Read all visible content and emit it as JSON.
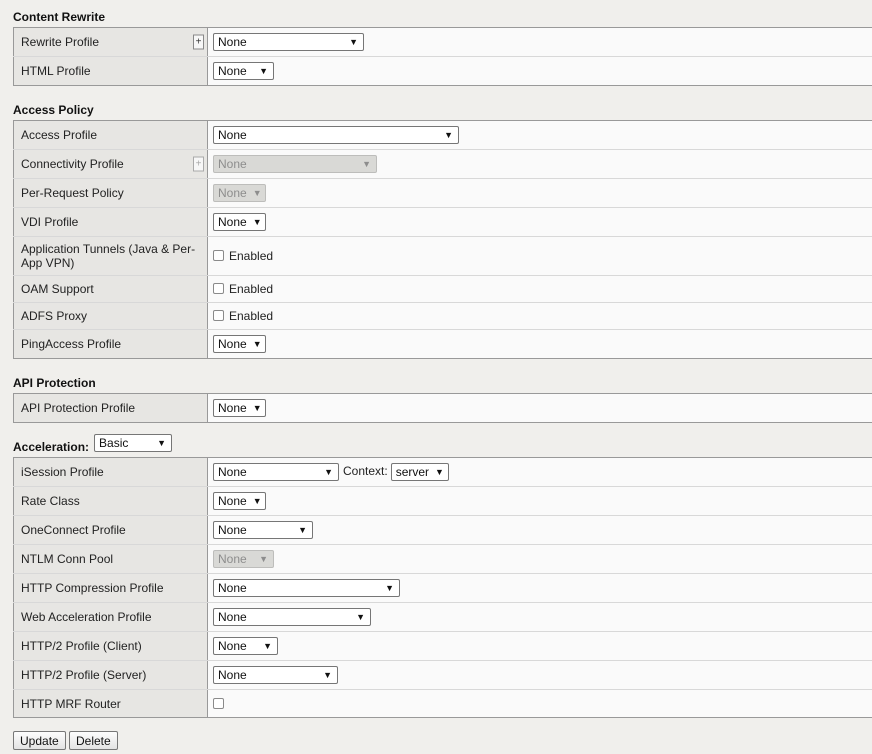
{
  "content_rewrite": {
    "title": "Content Rewrite",
    "rows": [
      {
        "label": "Rewrite Profile",
        "value": "None"
      },
      {
        "label": "HTML Profile",
        "value": "None"
      }
    ]
  },
  "access_policy": {
    "title": "Access Policy",
    "rows": [
      {
        "label": "Access Profile",
        "value": "None"
      },
      {
        "label": "Connectivity Profile",
        "value": "None"
      },
      {
        "label": "Per-Request Policy",
        "value": "None"
      },
      {
        "label": "VDI Profile",
        "value": "None"
      },
      {
        "label": "Application Tunnels (Java & Per-App VPN)",
        "value": "Enabled"
      },
      {
        "label": "OAM Support",
        "value": "Enabled"
      },
      {
        "label": "ADFS Proxy",
        "value": "Enabled"
      },
      {
        "label": "PingAccess Profile",
        "value": "None"
      }
    ]
  },
  "api_protection": {
    "title": "API Protection",
    "rows": [
      {
        "label": "API Protection Profile",
        "value": "None"
      }
    ]
  },
  "acceleration": {
    "title": "Acceleration:",
    "mode": "Basic",
    "context_label": "Context:",
    "context_value": "server",
    "rows": [
      {
        "label": "iSession Profile",
        "value": "None"
      },
      {
        "label": "Rate Class",
        "value": "None"
      },
      {
        "label": "OneConnect Profile",
        "value": "None"
      },
      {
        "label": "NTLM Conn Pool",
        "value": "None"
      },
      {
        "label": "HTTP Compression Profile",
        "value": "None"
      },
      {
        "label": "Web Acceleration Profile",
        "value": "None"
      },
      {
        "label": "HTTP/2 Profile (Client)",
        "value": "None"
      },
      {
        "label": "HTTP/2 Profile (Server)",
        "value": "None"
      },
      {
        "label": "HTTP MRF Router",
        "value": ""
      }
    ]
  },
  "icons": {
    "plus": "plus-icon",
    "arrow": "chevron-down-icon",
    "checkbox": "checkbox-unchecked"
  },
  "buttons": {
    "update": "Update",
    "delete": "Delete"
  }
}
